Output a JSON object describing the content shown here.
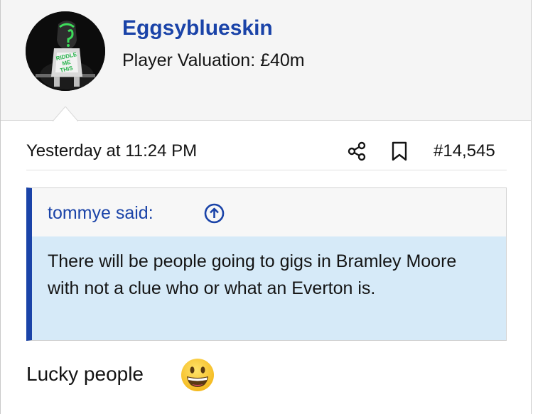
{
  "user": {
    "name": "Eggsyblueskin",
    "title": "Player Valuation: £40m",
    "avatar_icon": "riddler-avatar"
  },
  "post": {
    "date": "Yesterday at 11:24 PM",
    "number": "#14,545",
    "share_icon": "share-icon",
    "bookmark_icon": "bookmark-icon",
    "body": "Lucky people",
    "emoji_icon": "grinning-face-emoji"
  },
  "quote": {
    "author": "tommye said:",
    "jump_icon": "arrow-up-circle-icon",
    "text": "There will be people going to gigs in Bramley Moore with not a clue who or what an Everton is."
  },
  "colors": {
    "link": "#1a43a8",
    "quote_bar": "#1a43a8",
    "quote_body_bg": "#d6eaf8",
    "header_bg": "#f5f5f5"
  }
}
